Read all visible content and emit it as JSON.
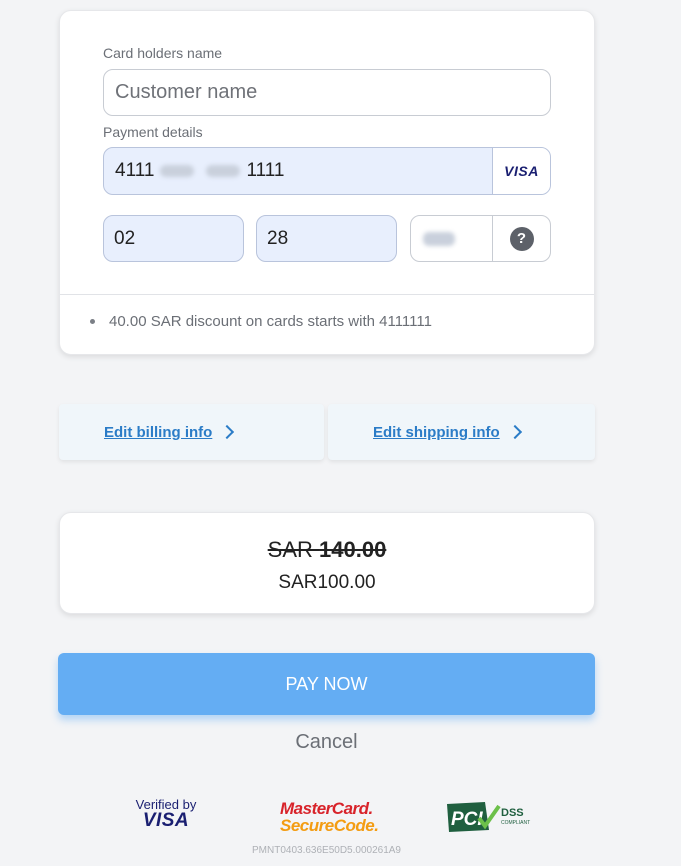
{
  "form": {
    "name_label": "Card holders name",
    "name_placeholder": "Customer name",
    "payment_label": "Payment details",
    "card_prefix": "4111",
    "card_suffix": "1111",
    "card_brand": "VISA",
    "exp_month": "02",
    "exp_year": "28",
    "cvv_help": "?",
    "discount_note": "40.00 SAR discount on cards starts with 4111111"
  },
  "links": {
    "billing": "Edit billing info",
    "shipping": "Edit shipping info"
  },
  "price": {
    "old_currency": "SAR ",
    "old_amount": "140.00",
    "new": "SAR100.00"
  },
  "actions": {
    "pay": "PAY NOW",
    "cancel": "Cancel"
  },
  "badges": {
    "visa_line1": "Verified by",
    "visa_line2": "VISA",
    "mc_line1": "MasterCard.",
    "mc_line2": "SecureCode.",
    "pci_main": "PCI",
    "pci_dss": "DSS",
    "pci_sub": "COMPLIANT"
  },
  "footer_code": "PMNT0403.636E50D5.000261A9",
  "colors": {
    "accent": "#64adf3",
    "link": "#2b7cc7",
    "field_bg": "#e8effd"
  }
}
